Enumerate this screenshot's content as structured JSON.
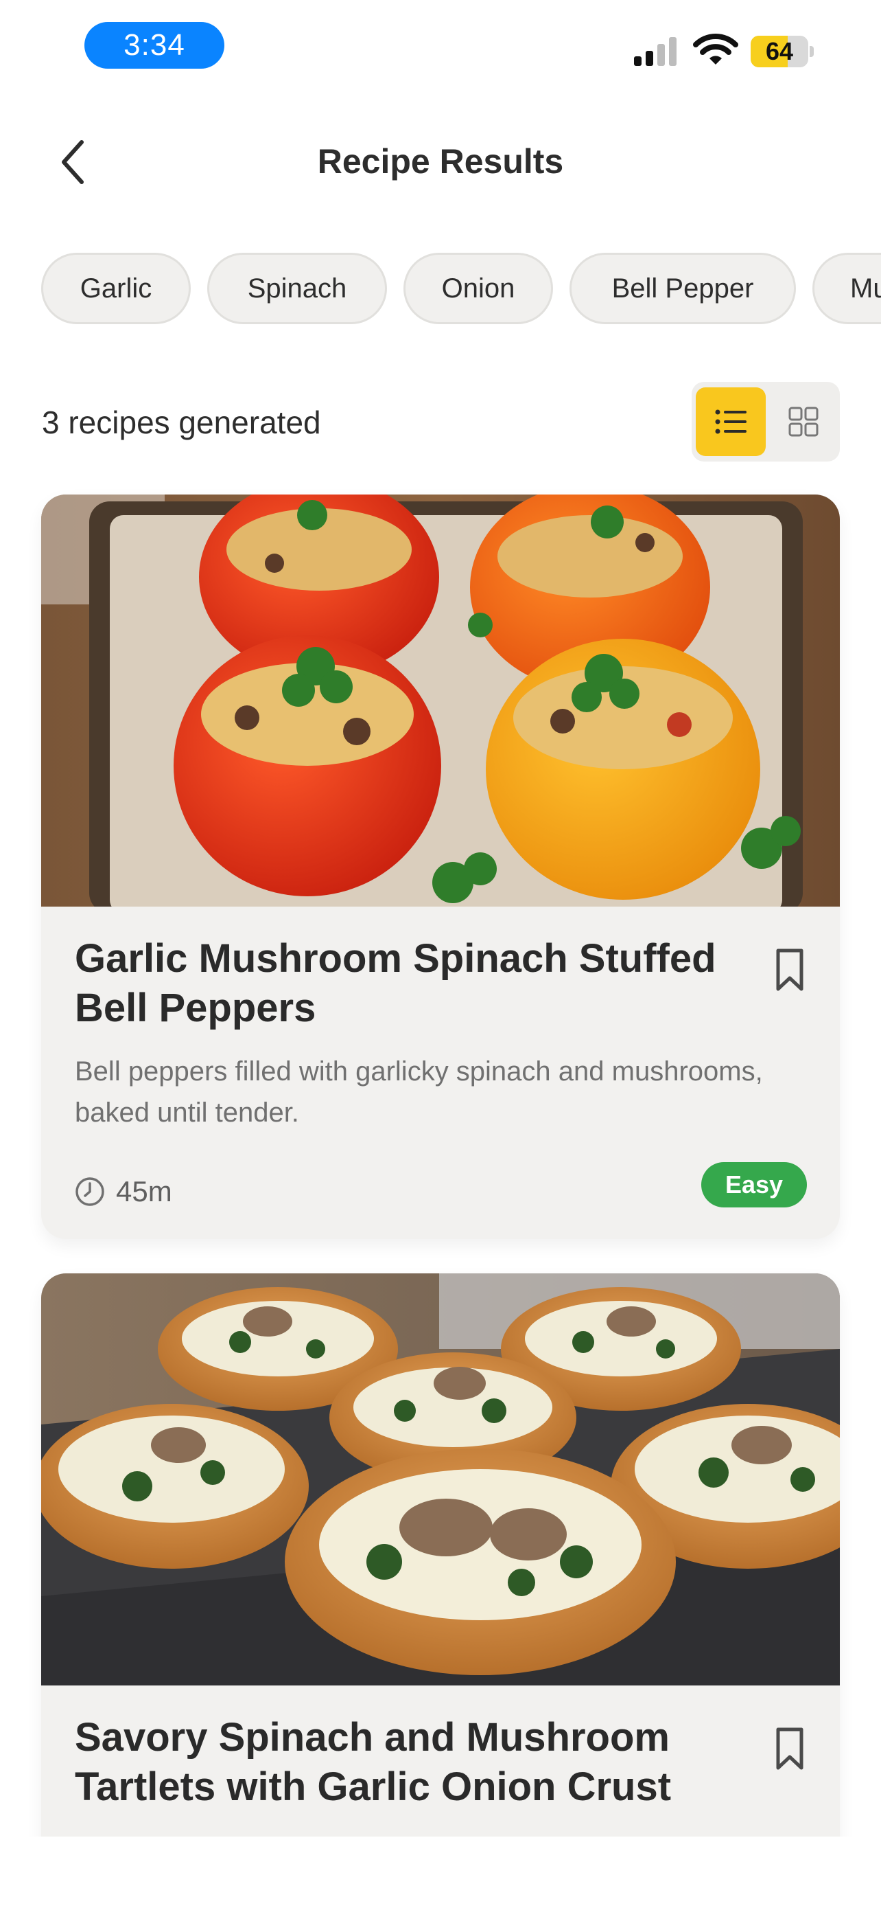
{
  "status_bar": {
    "time": "3:34",
    "battery": "64",
    "battery_level": 0.64,
    "accent": "#0a84ff"
  },
  "nav": {
    "title": "Recipe Results",
    "back_icon": "chevron-left-icon"
  },
  "ingredient_chips": [
    "Garlic",
    "Spinach",
    "Onion",
    "Bell Pepper",
    "Mu"
  ],
  "results": {
    "count_label": "3 recipes generated",
    "active_view": "list",
    "toggle_active_color": "#f9c71e"
  },
  "recipes": [
    {
      "title": "Garlic Mushroom Spinach Stuffed Bell Peppers",
      "description": "Bell peppers filled with garlicky spinach and mushrooms, baked until tender.",
      "time": "45m",
      "difficulty": "Easy",
      "difficulty_color": "#35a84c",
      "bookmark_icon": "bookmark-icon"
    },
    {
      "title": "Savory Spinach and Mushroom Tartlets with Garlic Onion Crust",
      "bookmark_icon": "bookmark-icon"
    }
  ]
}
